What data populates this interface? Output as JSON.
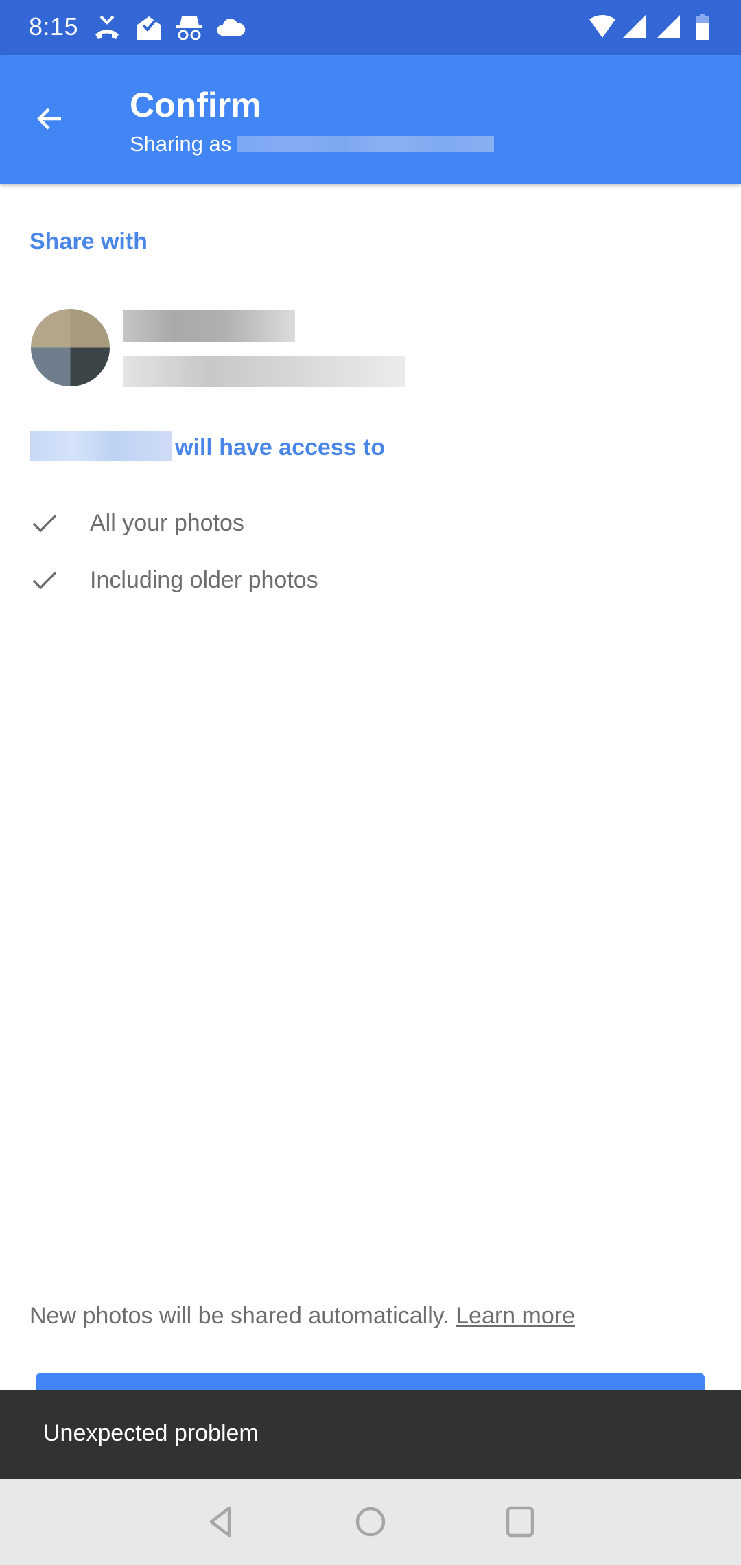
{
  "status_bar": {
    "time": "8:15",
    "left_icons": [
      "missed-call-icon",
      "mail-done-icon",
      "incognito-icon",
      "cloud-icon"
    ],
    "right_icons": [
      "wifi-icon",
      "signal-icon",
      "signal-icon",
      "battery-icon"
    ]
  },
  "app_bar": {
    "back_icon": "arrow-left-icon",
    "title": "Confirm",
    "subtitle_prefix": "Sharing as",
    "background": "#4285f4"
  },
  "share_section": {
    "header": "Share with",
    "recipient": {
      "avatar": "redacted",
      "name": "redacted",
      "email": "redacted"
    }
  },
  "access_section": {
    "header_suffix": "will have access to",
    "items": [
      {
        "icon": "check-icon",
        "label": "All your photos"
      },
      {
        "icon": "check-icon",
        "label": "Including older photos"
      }
    ]
  },
  "footer": {
    "note": "New photos will be shared automatically.",
    "learn_more": "Learn more"
  },
  "snackbar": {
    "message": "Unexpected problem"
  },
  "nav_bar": {
    "buttons": [
      "back-triangle-icon",
      "home-circle-icon",
      "recents-square-icon"
    ]
  },
  "colors": {
    "status_bar": "#3367d6",
    "accent": "#4a86e8",
    "snackbar": "#323232"
  }
}
